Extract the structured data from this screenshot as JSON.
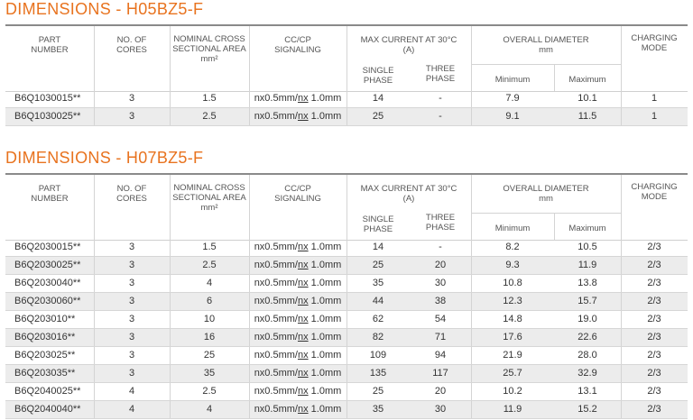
{
  "title1": "DIMENSIONS - H05BZ5-F",
  "title2": "DIMENSIONS - H07BZ5-F",
  "headers": {
    "part_number": [
      "PART",
      "NUMBER"
    ],
    "cores": [
      "NO. OF",
      "CORES"
    ],
    "area": [
      "NOMINAL CROSS",
      "SECTIONAL AREA",
      "mm²"
    ],
    "signaling": [
      "CC/CP",
      "SIGNALING"
    ],
    "max_current": [
      "MAX CURRENT  AT 30°C",
      "(A)"
    ],
    "single_phase": [
      "SINGLE",
      "PHASE"
    ],
    "three_phase": [
      "THREE",
      "PHASE"
    ],
    "overall_diameter": [
      "OVERALL DIAMETER",
      "mm"
    ],
    "minimum": "Minimum",
    "maximum": "Maximum",
    "charging_mode": [
      "CHARGING",
      "MODE"
    ]
  },
  "table1": [
    [
      "B6Q1030015**",
      "3",
      "1.5",
      "nx0.5mm/",
      "nx",
      " 1.0mm",
      "14",
      "-",
      "7.9",
      "10.1",
      "1"
    ],
    [
      "B6Q1030025**",
      "3",
      "2.5",
      "nx0.5mm/",
      "nx",
      " 1.0mm",
      "25",
      "-",
      "9.1",
      "11.5",
      "1"
    ]
  ],
  "table2": [
    [
      "B6Q2030015**",
      "3",
      "1.5",
      "nx0.5mm/",
      "nx",
      " 1.0mm",
      "14",
      "-",
      "8.2",
      "10.5",
      "2/3"
    ],
    [
      "B6Q2030025**",
      "3",
      "2.5",
      "nx0.5mm/",
      "nx",
      " 1.0mm",
      "25",
      "20",
      "9.3",
      "11.9",
      "2/3"
    ],
    [
      "B6Q2030040**",
      "3",
      "4",
      "nx0.5mm/",
      "nx",
      " 1.0mm",
      "35",
      "30",
      "10.8",
      "13.8",
      "2/3"
    ],
    [
      "B6Q2030060**",
      "3",
      "6",
      "nx0.5mm/",
      "nx",
      " 1.0mm",
      "44",
      "38",
      "12.3",
      "15.7",
      "2/3"
    ],
    [
      "B6Q203010**",
      "3",
      "10",
      "nx0.5mm/",
      "nx",
      " 1.0mm",
      "62",
      "54",
      "14.8",
      "19.0",
      "2/3"
    ],
    [
      "B6Q203016**",
      "3",
      "16",
      "nx0.5mm/",
      "nx",
      " 1.0mm",
      "82",
      "71",
      "17.6",
      "22.6",
      "2/3"
    ],
    [
      "B6Q203025**",
      "3",
      "25",
      "nx0.5mm/",
      "nx",
      " 1.0mm",
      "109",
      "94",
      "21.9",
      "28.0",
      "2/3"
    ],
    [
      "B6Q203035**",
      "3",
      "35",
      "nx0.5mm/",
      "nx",
      " 1.0mm",
      "135",
      "117",
      "25.7",
      "32.9",
      "2/3"
    ],
    [
      "B6Q2040025**",
      "4",
      "2.5",
      "nx0.5mm/",
      "nx",
      " 1.0mm",
      "25",
      "20",
      "10.2",
      "13.1",
      "2/3"
    ],
    [
      "B6Q2040040**",
      "4",
      "4",
      "nx0.5mm/",
      "nx",
      " 1.0mm",
      "35",
      "30",
      "11.9",
      "15.2",
      "2/3"
    ]
  ],
  "colors": {
    "title": "#e8731f",
    "alt_row": "#ececec",
    "border": "#8a8a8a"
  }
}
